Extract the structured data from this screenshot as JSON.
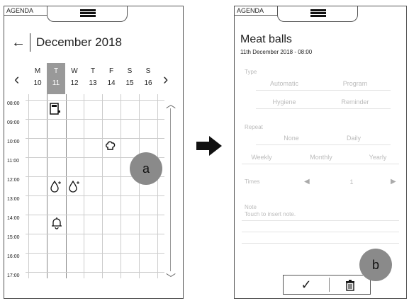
{
  "app": {
    "tab_label": "AGENDA"
  },
  "calendar": {
    "month_label": "December 2018",
    "days": [
      {
        "letter": "M",
        "num": "10"
      },
      {
        "letter": "T",
        "num": "11"
      },
      {
        "letter": "W",
        "num": "12"
      },
      {
        "letter": "T",
        "num": "13"
      },
      {
        "letter": "F",
        "num": "14"
      },
      {
        "letter": "S",
        "num": "15"
      },
      {
        "letter": "S",
        "num": "16"
      }
    ],
    "selected_day": "11",
    "hours": [
      "08:00",
      "09:00",
      "10:00",
      "11:00",
      "12:00",
      "13:00",
      "14:00",
      "15:00",
      "16:00",
      "17:00"
    ]
  },
  "annotations": {
    "a": "a",
    "b": "b"
  },
  "detail": {
    "title": "Meat balls",
    "subtitle": "11th December 2018 - 08:00",
    "type_label": "Type",
    "type_options": [
      "Automatic",
      "Program",
      "Hygiene",
      "Reminder"
    ],
    "repeat_label": "Repeat",
    "repeat_options": [
      "None",
      "Daily",
      "Weekly",
      "Monthly",
      "Yearly"
    ],
    "times_label": "Times",
    "times_value": "1",
    "note_label": "Note",
    "note_placeholder": "Touch to insert note.",
    "confirm_glyph": "✓"
  }
}
